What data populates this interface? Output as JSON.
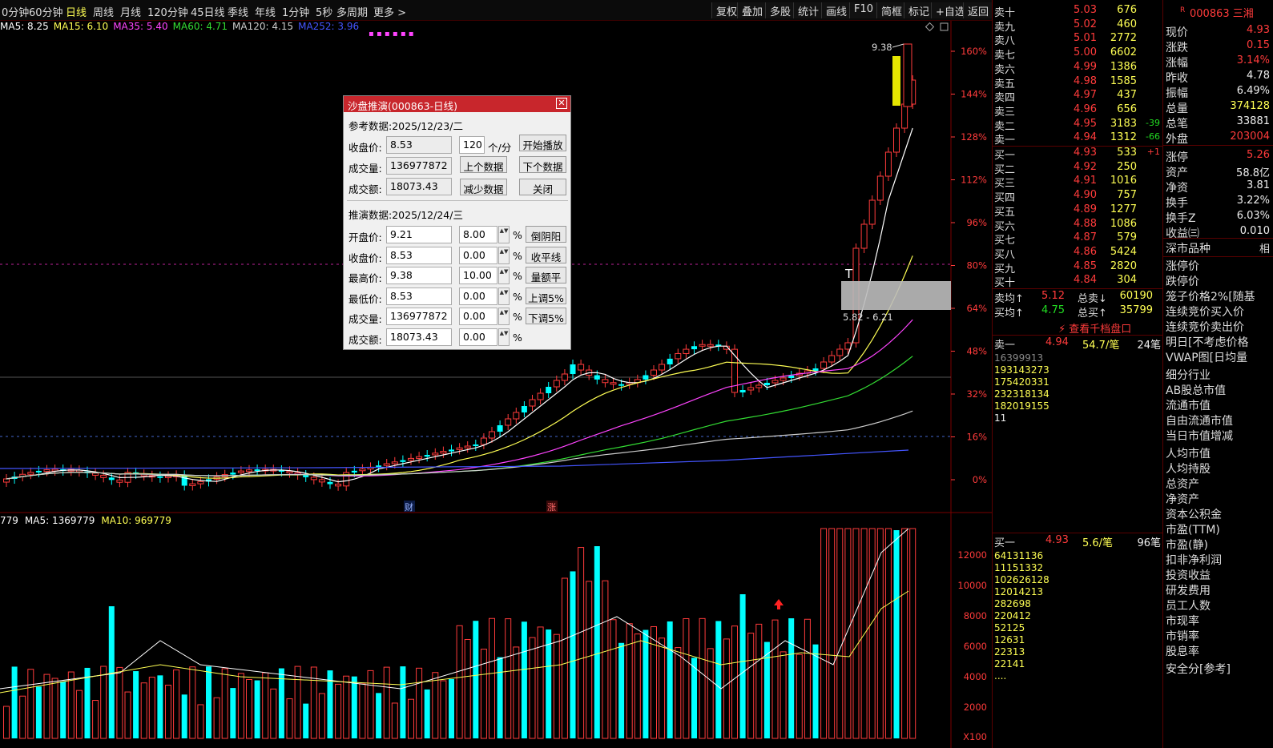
{
  "toolbar": {
    "periods": [
      "0分钟",
      "60分钟",
      "日线",
      "周线",
      "月线",
      "120分钟",
      "45日线",
      "季线",
      "年线",
      "1分钟",
      "5秒",
      "多周期",
      "更多 >"
    ],
    "active_period": "日线",
    "right_buttons": [
      "复权",
      "叠加",
      "多股",
      "统计",
      "画线",
      "F10",
      "简框",
      "标记",
      "+自选",
      "返回"
    ]
  },
  "ma_legend": [
    {
      "text": "MA5: 8.25",
      "color": "#ffffff"
    },
    {
      "text": "MA15: 6.10",
      "color": "#ffff54"
    },
    {
      "text": "MA35: 5.40",
      "color": "#ff44ff"
    },
    {
      "text": "MA60: 4.71",
      "color": "#33dd33"
    },
    {
      "text": "MA120: 4.15",
      "color": "#cccccc"
    },
    {
      "text": "MA252: 3.96",
      "color": "#4455ff"
    }
  ],
  "vol_legend": [
    {
      "text": "779",
      "color": "#ffffff"
    },
    {
      "text": "MA5: 1369779",
      "color": "#ffffff"
    },
    {
      "text": "MA10: 969779",
      "color": "#ffff54"
    }
  ],
  "price_axis": [
    "160%",
    "144%",
    "128%",
    "112%",
    "96%",
    "80%",
    "64%",
    "48%",
    "32%",
    "16%",
    "0%"
  ],
  "vol_axis": [
    "12000",
    "10000",
    "8000",
    "6000",
    "4000",
    "2000",
    "X100"
  ],
  "markers": {
    "cai": "财",
    "zhang": "涨",
    "t": "T"
  },
  "annotations": {
    "high_label": "9.38",
    "range_label": "5.82 - 6.21"
  },
  "colors": {
    "up": "#ff3b3b",
    "down": "#00ffff",
    "bg": "#000000"
  },
  "dialog": {
    "title": "沙盘推演(000863-日线)",
    "close_icon": "close-icon",
    "ref_heading": "参考数据:2025/12/23/二",
    "ref_rows": [
      {
        "label": "收盘价:",
        "value": "8.53"
      },
      {
        "label": "成交量:",
        "value": "136977872"
      },
      {
        "label": "成交额:",
        "value": "18073.43"
      }
    ],
    "speed_value": "120",
    "speed_unit": "个/分",
    "buttons": {
      "play": "开始播放",
      "prev": "上个数据",
      "next": "下个数据",
      "reduce": "减少数据",
      "close": "关闭"
    },
    "sim_heading": "推演数据:2025/12/24/三",
    "sim_rows": [
      {
        "label": "开盘价:",
        "value": "9.21",
        "pct": "8.00",
        "unit": "%",
        "btn": "倒阴阳"
      },
      {
        "label": "收盘价:",
        "value": "8.53",
        "pct": "0.00",
        "unit": "%",
        "btn": "收平线"
      },
      {
        "label": "最高价:",
        "value": "9.38",
        "pct": "10.00",
        "unit": "%",
        "btn": "量额平"
      },
      {
        "label": "最低价:",
        "value": "8.53",
        "pct": "0.00",
        "unit": "%",
        "btn": "上调5%"
      },
      {
        "label": "成交量:",
        "value": "136977872",
        "pct": "0.00",
        "unit": "%",
        "btn": "下调5%"
      },
      {
        "label": "成交额:",
        "value": "18073.43",
        "pct": "0.00",
        "unit": "%",
        "btn": ""
      }
    ]
  },
  "orderbook": {
    "sell": [
      {
        "label": "卖十",
        "price": "5.03",
        "vol": "676",
        "chg": ""
      },
      {
        "label": "卖九",
        "price": "5.02",
        "vol": "460",
        "chg": ""
      },
      {
        "label": "卖八",
        "price": "5.01",
        "vol": "2772",
        "chg": ""
      },
      {
        "label": "卖七",
        "price": "5.00",
        "vol": "6602",
        "chg": ""
      },
      {
        "label": "卖六",
        "price": "4.99",
        "vol": "1386",
        "chg": ""
      },
      {
        "label": "卖五",
        "price": "4.98",
        "vol": "1585",
        "chg": ""
      },
      {
        "label": "卖四",
        "price": "4.97",
        "vol": "437",
        "chg": ""
      },
      {
        "label": "卖三",
        "price": "4.96",
        "vol": "656",
        "chg": ""
      },
      {
        "label": "卖二",
        "price": "4.95",
        "vol": "3183",
        "chg": "-39"
      },
      {
        "label": "卖一",
        "price": "4.94",
        "vol": "1312",
        "chg": "-66"
      }
    ],
    "buy": [
      {
        "label": "买一",
        "price": "4.93",
        "vol": "533",
        "chg": "+1"
      },
      {
        "label": "买二",
        "price": "4.92",
        "vol": "250",
        "chg": ""
      },
      {
        "label": "买三",
        "price": "4.91",
        "vol": "1016",
        "chg": ""
      },
      {
        "label": "买四",
        "price": "4.90",
        "vol": "757",
        "chg": ""
      },
      {
        "label": "买五",
        "price": "4.89",
        "vol": "1277",
        "chg": ""
      },
      {
        "label": "买六",
        "price": "4.88",
        "vol": "1086",
        "chg": ""
      },
      {
        "label": "买七",
        "price": "4.87",
        "vol": "579",
        "chg": ""
      },
      {
        "label": "买八",
        "price": "4.86",
        "vol": "5424",
        "chg": ""
      },
      {
        "label": "买九",
        "price": "4.85",
        "vol": "2820",
        "chg": ""
      },
      {
        "label": "买十",
        "price": "4.84",
        "vol": "304",
        "chg": ""
      }
    ],
    "avg_sell": {
      "label": "卖均",
      "price": "5.12",
      "total_label": "总卖",
      "total": "60190"
    },
    "avg_buy": {
      "label": "买均",
      "price": "4.75",
      "total_label": "总买",
      "total": "35799"
    },
    "link": "查看千档盘口",
    "sell1_queue": {
      "label": "卖一",
      "price": "4.94",
      "per": "54.7/笔",
      "count": "24笔",
      "rows": [
        [
          "16",
          "39",
          "9",
          "9",
          "13"
        ],
        [
          "1",
          "931",
          "43",
          "27",
          "3"
        ],
        [
          "17",
          "54",
          "20",
          "3",
          "31"
        ],
        [
          "23",
          "23",
          "18",
          "13",
          "4"
        ],
        [
          "18",
          "20",
          "19",
          "15",
          "5"
        ],
        [
          "1",
          "1",
          "",
          "",
          ""
        ]
      ]
    },
    "buy1_queue": {
      "label": "买一",
      "price": "4.93",
      "per": "5.6/笔",
      "count": "96笔",
      "rows": [
        [
          "64",
          "13",
          "1",
          "13",
          "6"
        ],
        [
          "1",
          "1",
          "15",
          "13",
          "32"
        ],
        [
          "10",
          "26",
          "26",
          "12",
          "8"
        ],
        [
          "1",
          "20",
          "14",
          "2",
          "13"
        ],
        [
          "28",
          "2",
          "6",
          "9",
          "8"
        ],
        [
          "2",
          "20",
          "4",
          "1",
          "2"
        ],
        [
          "5",
          "2",
          "1",
          "2",
          "5"
        ],
        [
          "1",
          "2",
          "6",
          "3",
          "1"
        ],
        [
          "2",
          "2",
          "3",
          "1",
          "3"
        ],
        [
          "2",
          "2",
          "1",
          "4",
          "1"
        ],
        [
          "....",
          "",
          "",
          "",
          ""
        ]
      ]
    }
  },
  "stock": {
    "code": "000863",
    "name": "三湘",
    "badge": "R",
    "rows": [
      {
        "label": "现价",
        "value": "4.93",
        "color": "#ff3b3b"
      },
      {
        "label": "涨跌",
        "value": "0.15",
        "color": "#ff3b3b"
      },
      {
        "label": "涨幅",
        "value": "3.14%",
        "color": "#ff3b3b"
      },
      {
        "label": "昨收",
        "value": "4.78",
        "color": "#eeeeee"
      },
      {
        "label": "振幅",
        "value": "6.49%",
        "color": "#eeeeee"
      },
      {
        "label": "总量",
        "value": "374128",
        "color": "#ffff54"
      },
      {
        "label": "总笔",
        "value": "33881",
        "color": "#eeeeee"
      },
      {
        "label": "外盘",
        "value": "203004",
        "color": "#ff3b3b"
      },
      {
        "label": "涨停",
        "value": "5.26",
        "color": "#ff3b3b"
      },
      {
        "label": "资产",
        "value": "58.8亿",
        "color": "#eeeeee"
      },
      {
        "label": "净资",
        "value": "3.81",
        "color": "#eeeeee"
      },
      {
        "label": "换手",
        "value": "3.22%",
        "color": "#eeeeee"
      },
      {
        "label": "换手Z",
        "value": "6.03%",
        "color": "#eeeeee"
      },
      {
        "label": "收益㈢",
        "value": "0.010",
        "color": "#eeeeee"
      }
    ],
    "market": "深市品种",
    "market_right": "相",
    "lines": [
      "涨停价",
      "跌停价",
      "笼子价格2%[随基",
      "连续竞价买入价",
      "连续竞价卖出价",
      "明日[不考虑价格",
      "VWAP图[日均量",
      "细分行业",
      "AB股总市值",
      "流通市值",
      "自由流通市值",
      "当日市值增减",
      "人均市值",
      "人均持股",
      "总资产",
      "净资产",
      "资本公积金",
      "市盈(TTM)",
      "市盈(静)",
      "扣非净利润",
      "投资收益",
      "研发费用",
      "员工人数",
      "市现率",
      "市销率",
      "股息率",
      "安全分[参考]"
    ]
  }
}
